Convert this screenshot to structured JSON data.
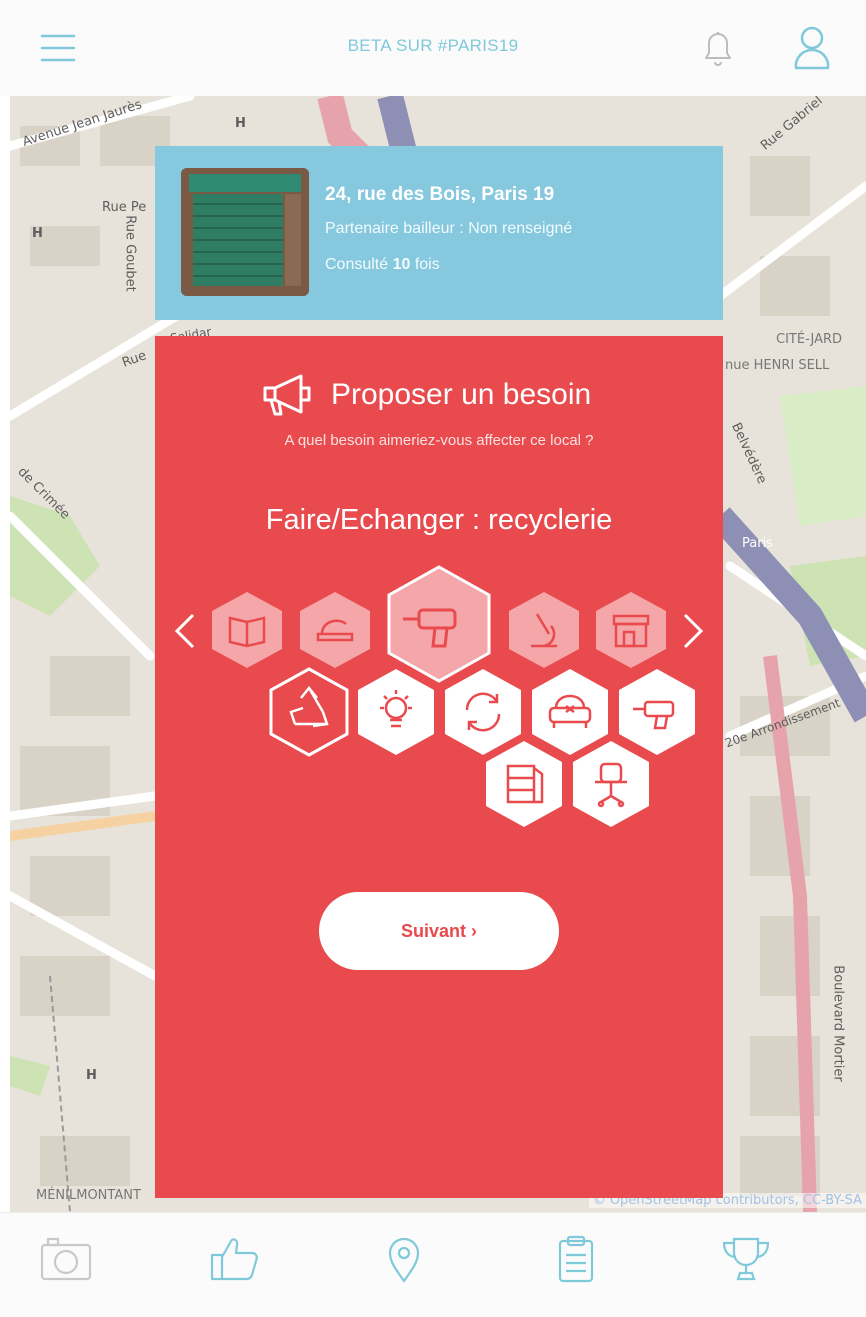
{
  "header": {
    "title": "BETA SUR #PARIS19",
    "menu_icon": "hamburger-menu-icon",
    "bell_icon": "bell-icon",
    "user_icon": "user-icon"
  },
  "map": {
    "labels": [
      "Avenue Jean Jaurès",
      "Rue Pe",
      "Rue Goubet",
      "Rue",
      "Solidar",
      "de Crimée",
      "CITÉ-JARD",
      "nue HENRI SELL",
      "Belvédère",
      "Paris",
      "20e Arrondissement",
      "Boulevard Mortier",
      "MÉNILMONTANT",
      "Rue Gabriel",
      "H"
    ],
    "attribution": "© OpenStreetMap contributors, CC-BY-SA"
  },
  "location": {
    "address": "24, rue des Bois, Paris 19",
    "partner": "Partenaire bailleur : Non renseigné",
    "consulted_prefix": "Consulté ",
    "consulted_count": "10",
    "consulted_suffix": " fois"
  },
  "panel": {
    "title": "Proposer un besoin",
    "subtitle": "A quel besoin aimeriez-vous affecter ce local ?",
    "selected_category": "Faire/Echanger : recyclerie",
    "next_label": "Suivant ›",
    "categories": [
      {
        "icon": "book-icon",
        "selected": false
      },
      {
        "icon": "hat-icon",
        "selected": false
      },
      {
        "icon": "drill-icon",
        "selected": true
      },
      {
        "icon": "microscope-icon",
        "selected": false
      },
      {
        "icon": "shop-icon",
        "selected": false
      }
    ],
    "subcategories": [
      {
        "icon": "recycle-icon",
        "selected": true
      },
      {
        "icon": "lightbulb-icon",
        "selected": false
      },
      {
        "icon": "exchange-arrows-icon",
        "selected": false
      },
      {
        "icon": "armchair-icon",
        "selected": false
      },
      {
        "icon": "drill-icon",
        "selected": false
      },
      {
        "icon": "shelves-icon",
        "selected": false
      },
      {
        "icon": "office-chair-icon",
        "selected": false
      }
    ]
  },
  "bottom_nav": [
    {
      "icon": "camera-icon"
    },
    {
      "icon": "thumbs-up-icon"
    },
    {
      "icon": "map-pin-icon"
    },
    {
      "icon": "clipboard-icon"
    },
    {
      "icon": "trophy-icon"
    }
  ],
  "colors": {
    "accent_blue": "#7fc9db",
    "card_blue": "#86c8dd",
    "panel_red": "#e84a4e"
  }
}
